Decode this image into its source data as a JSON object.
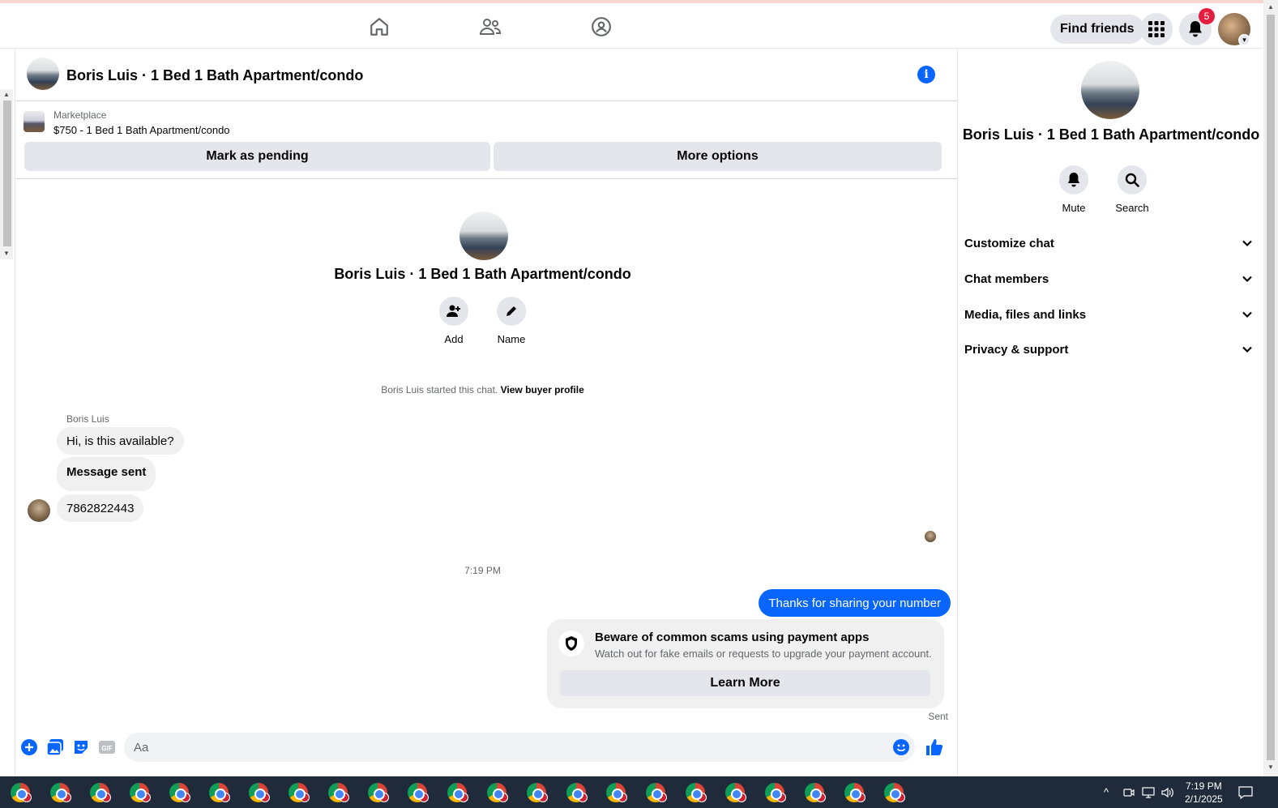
{
  "topbar": {
    "find_friends_label": "Find friends",
    "notification_count": "5",
    "accent_color": "#0866ff"
  },
  "chat": {
    "title": "Boris Luis · 1 Bed 1 Bath Apartment/condo",
    "marketplace_label": "Marketplace",
    "listing": "$750 - 1 Bed 1 Bath Apartment/condo",
    "mark_pending_label": "Mark as pending",
    "more_options_label": "More options",
    "center_title": "Boris Luis · 1 Bed 1 Bath Apartment/condo",
    "add_label": "Add",
    "name_label": "Name",
    "started_text": "Boris Luis started this chat.",
    "view_profile_label": "View buyer profile",
    "sender_name": "Boris Luis",
    "messages_in": [
      "Hi, is this available?",
      "Message sent",
      "7862822443"
    ],
    "timestamp": "7:19 PM",
    "message_out": "Thanks for sharing your number",
    "scam_title": "Beware of common scams using payment apps",
    "scam_desc": "Watch out for fake emails or requests to upgrade your payment account.",
    "learn_more_label": "Learn More",
    "sent_status": "Sent",
    "composer_placeholder": "Aa"
  },
  "right_panel": {
    "title": "Boris Luis · 1 Bed 1 Bath Apartment/condo",
    "mute_label": "Mute",
    "search_label": "Search",
    "sections": [
      "Customize chat",
      "Chat members",
      "Media, files and links",
      "Privacy & support"
    ]
  },
  "taskbar": {
    "time": "7:19 PM",
    "date": "2/1/2025"
  }
}
